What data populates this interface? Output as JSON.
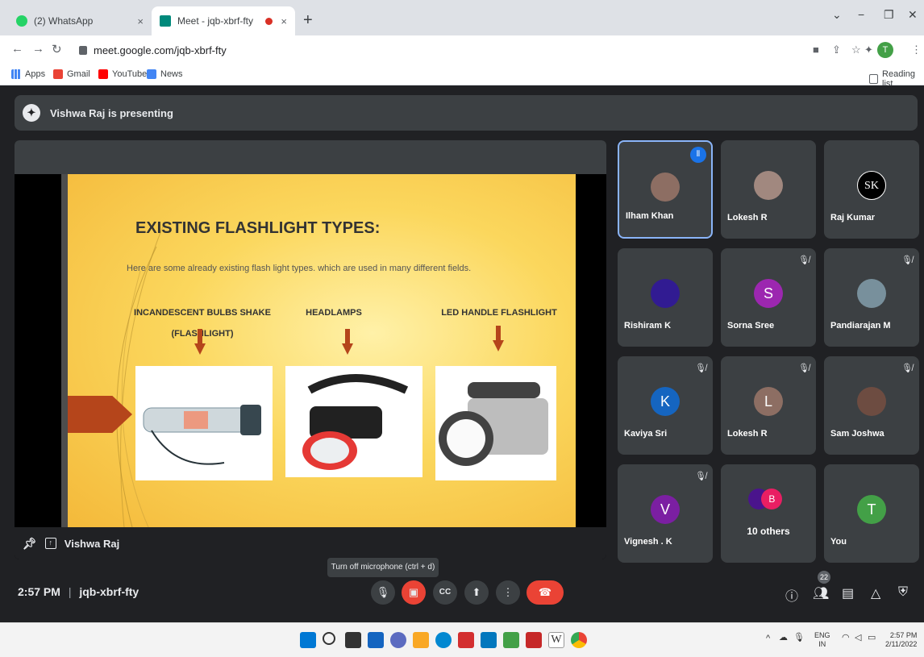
{
  "browser": {
    "tabs": [
      {
        "title": "(2) WhatsApp",
        "close": "×"
      },
      {
        "title": "Meet - jqb-xbrf-fty",
        "close": "×"
      }
    ],
    "new_tab": "+",
    "address": "meet.google.com/jqb-xbrf-fty",
    "profile_initial": "T",
    "bookmarks": [
      "Apps",
      "Gmail",
      "YouTube",
      "News"
    ],
    "reading_list": "Reading list"
  },
  "meet": {
    "presenting_banner": "Vishwa Raj is presenting",
    "presenter_label": "Vishwa Raj",
    "slide": {
      "title": "EXISTING FLASHLIGHT TYPES:",
      "subtitle": "Here are some already existing flash light types. which are used in many different fields.",
      "categories": [
        "INCANDESCENT BULBS SHAKE (FLASHLIGHT)",
        "HEADLAMPS",
        "LED HANDLE FLASHLIGHT"
      ]
    },
    "participants": [
      {
        "name": "Ilham Khan",
        "initial": "",
        "color": "#8d6e63"
      },
      {
        "name": "Lokesh R",
        "initial": "",
        "color": "#a1887f"
      },
      {
        "name": "Raj Kumar",
        "initial": "",
        "color": "#000000"
      },
      {
        "name": "Rishiram K",
        "initial": "",
        "color": "#311b92"
      },
      {
        "name": "Sorna Sree",
        "initial": "S",
        "color": "#9c27b0"
      },
      {
        "name": "Pandiarajan M",
        "initial": "",
        "color": "#78909c"
      },
      {
        "name": "Kaviya Sri",
        "initial": "K",
        "color": "#1565c0"
      },
      {
        "name": "Lokesh R",
        "initial": "L",
        "color": "#8d6e63"
      },
      {
        "name": "Sam Joshwa",
        "initial": "",
        "color": "#6d4c41"
      },
      {
        "name": "Vignesh . K",
        "initial": "V",
        "color": "#7b1fa2"
      },
      {
        "name": "10 others",
        "initial": "B",
        "color": "#e91e63"
      },
      {
        "name": "You",
        "initial": "T",
        "color": "#43a047"
      }
    ],
    "clock": "2:57 PM",
    "separator": "|",
    "meeting_code": "jqb-xbrf-fty",
    "tooltip": "Turn off microphone (ctrl + d)",
    "people_count": "22"
  },
  "taskbar": {
    "lang": "ENG",
    "region": "IN",
    "time": "2:57 PM",
    "date": "2/11/2022"
  }
}
